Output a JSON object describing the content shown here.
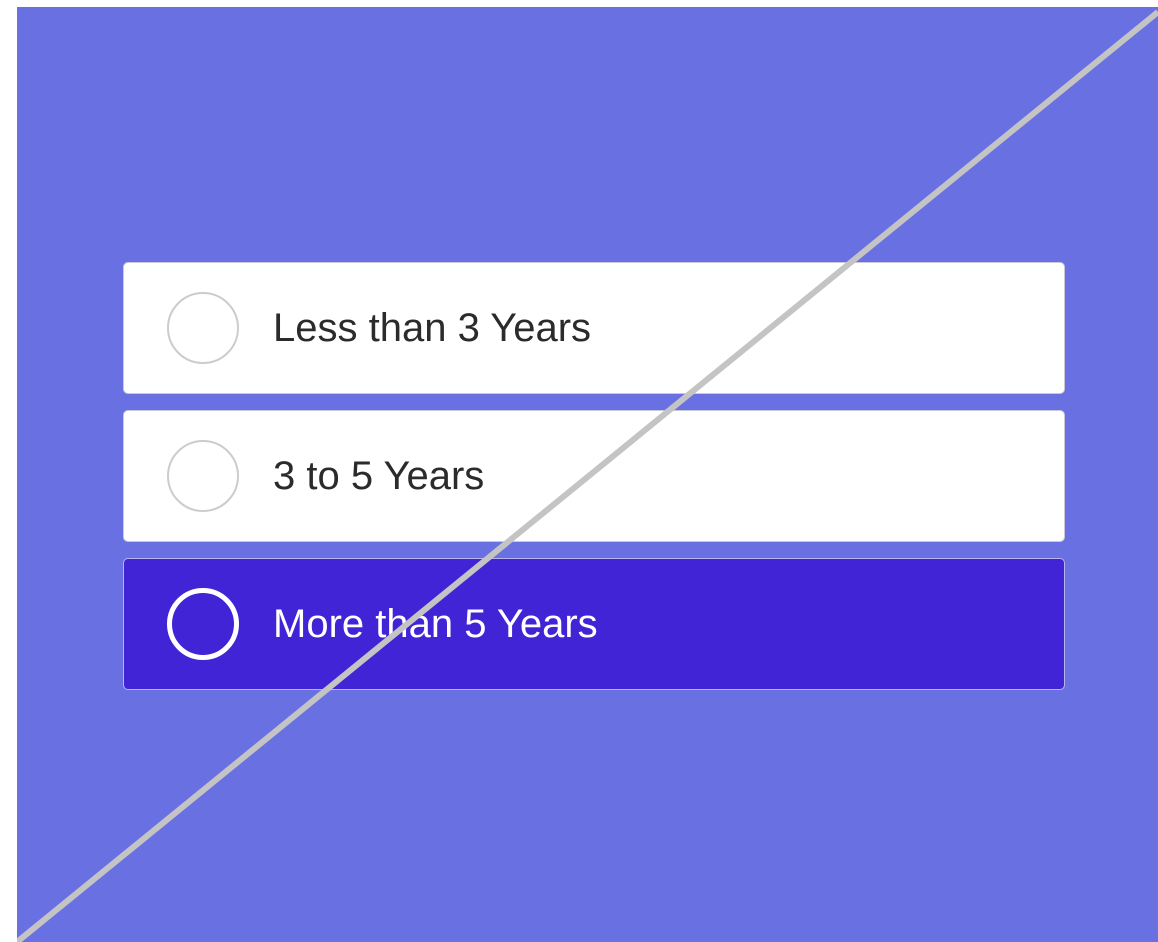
{
  "question": {
    "options": [
      {
        "label": "Less than 3 Years",
        "selected": false
      },
      {
        "label": "3 to 5 Years",
        "selected": false
      },
      {
        "label": "More than 5 Years",
        "selected": true
      }
    ]
  },
  "colors": {
    "background": "#6970e2",
    "option_bg": "#ffffff",
    "selected_bg": "#4024d6",
    "slash_line": "#c4c4c4"
  }
}
